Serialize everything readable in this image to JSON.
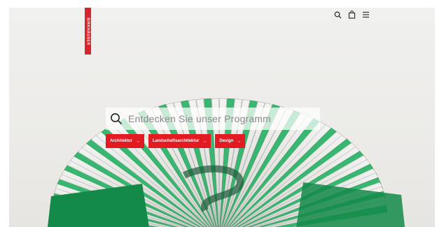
{
  "brand": {
    "name": "BIRKHÄUSER"
  },
  "header": {
    "icons": [
      "search-icon",
      "shopping-bag-icon",
      "menu-icon"
    ]
  },
  "search": {
    "placeholder": "Entdecken Sie unser Programm",
    "icon": "search-icon"
  },
  "categories": [
    {
      "label": "Architektur",
      "arrow": "→"
    },
    {
      "label": "Landschaftsarchitektur",
      "arrow": "→"
    },
    {
      "label": "Design",
      "arrow": "→"
    }
  ],
  "colors": {
    "brand_red": "#e21b23",
    "background": "#ecebe8",
    "accent_green": "#2fb56a"
  }
}
